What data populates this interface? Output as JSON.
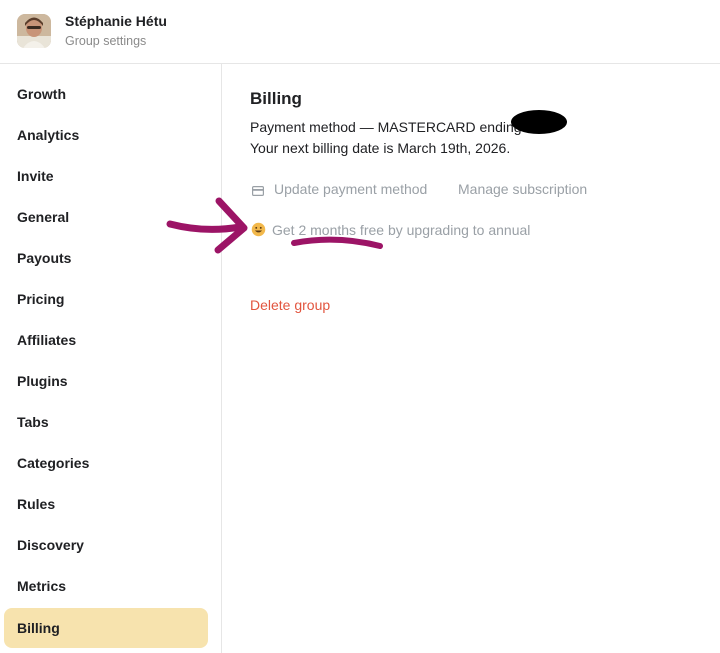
{
  "header": {
    "user_name": "Stéphanie Hétu",
    "subtitle": "Group settings"
  },
  "sidebar": {
    "items": [
      {
        "label": "Growth"
      },
      {
        "label": "Analytics"
      },
      {
        "label": "Invite"
      },
      {
        "label": "General"
      },
      {
        "label": "Payouts"
      },
      {
        "label": "Pricing"
      },
      {
        "label": "Affiliates"
      },
      {
        "label": "Plugins"
      },
      {
        "label": "Tabs"
      },
      {
        "label": "Categories"
      },
      {
        "label": "Rules"
      },
      {
        "label": "Discovery"
      },
      {
        "label": "Metrics"
      },
      {
        "label": "Billing"
      }
    ],
    "active": "Billing"
  },
  "billing": {
    "title": "Billing",
    "payment_method": "Payment method — MASTERCARD ending i",
    "next_billing": "Your next billing date is March 19th, 2026.",
    "update_payment": "Update payment method",
    "manage_subscription": "Manage subscription",
    "promo": "Get 2 months free by upgrading to annual",
    "delete_group": "Delete group"
  },
  "icons": {
    "card": "credit-card-icon",
    "promo": "grinning-face-icon"
  },
  "colors": {
    "active_bg": "#f7e3ae",
    "danger": "#e2553f",
    "muted_link": "#9aa0a6",
    "annotation": "#9c1466",
    "redaction": "#000000"
  }
}
